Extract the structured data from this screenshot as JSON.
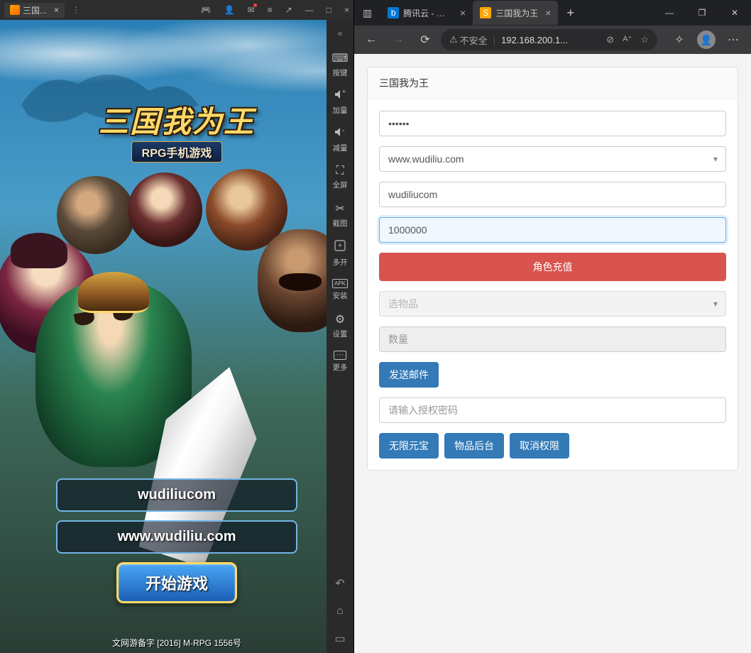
{
  "emulator": {
    "tab_title": "三国...",
    "sidebar": {
      "collapse": "«",
      "items": [
        {
          "icon": "⌨",
          "label": "按键"
        },
        {
          "icon": "🔊+",
          "label": "加量"
        },
        {
          "icon": "🔊−",
          "label": "减量"
        },
        {
          "icon": "⛶",
          "label": "全屏"
        },
        {
          "icon": "✂",
          "label": "截图"
        },
        {
          "icon": "⊕",
          "label": "多开"
        },
        {
          "icon": "APK",
          "label": "安装"
        },
        {
          "icon": "⚙",
          "label": "设置"
        },
        {
          "icon": "⋯",
          "label": "更多"
        }
      ]
    },
    "game": {
      "logo_title": "三国我为王",
      "logo_sub": "RPG手机游戏",
      "field1": "wudiliucom",
      "field2": "www.wudiliu.com",
      "start_btn": "开始游戏",
      "footer": "文网游备字 [2016] M-RPG 1556号"
    }
  },
  "browser": {
    "tabs": [
      {
        "label": "腾讯云 - 搜狗",
        "active": false,
        "favicon_bg": "#0078d4",
        "favicon_text": "b"
      },
      {
        "label": "三国我为王",
        "active": true,
        "favicon_bg": "#ffa500",
        "favicon_text": "S"
      }
    ],
    "addr_warn": "不安全",
    "addr_url": "192.168.200.1...",
    "panel_title": "三国我为王",
    "form": {
      "password_value": "••••••",
      "domain_value": "www.wudiliu.com",
      "user_value": "wudiliucom",
      "amount_value": "1000000",
      "recharge_btn": "角色充值",
      "item_placeholder": "选物品",
      "qty_placeholder": "数量",
      "send_mail_btn": "发送邮件",
      "auth_placeholder": "请输入授权密码",
      "btn_unlimited": "无限元宝",
      "btn_items": "物品后台",
      "btn_cancel": "取消权限"
    }
  }
}
